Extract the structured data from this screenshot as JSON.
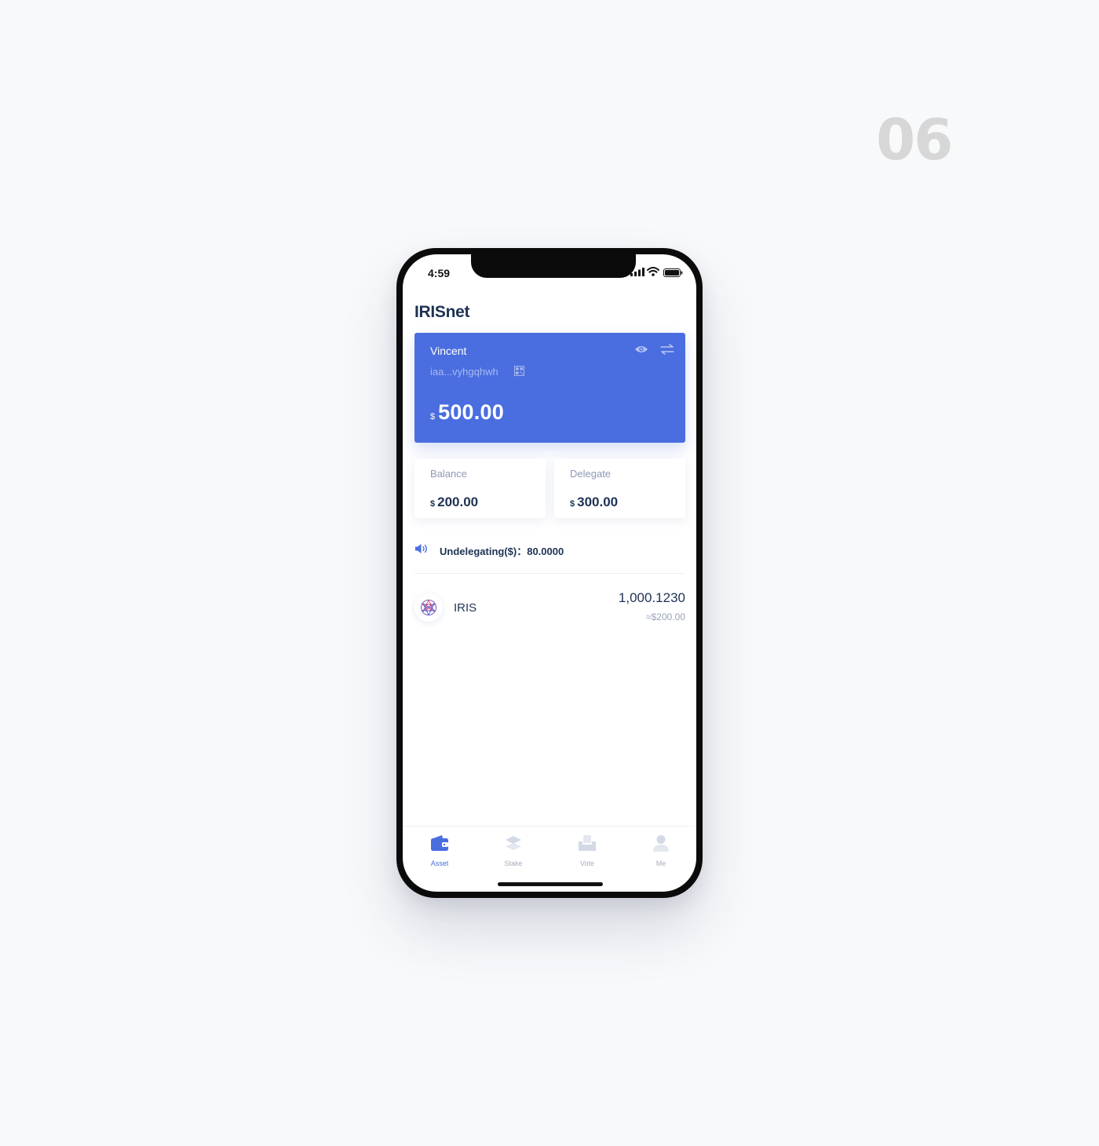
{
  "slide": {
    "number": "06"
  },
  "status_bar": {
    "time": "4:59"
  },
  "app": {
    "title": "IRISnet"
  },
  "wallet": {
    "name": "Vincent",
    "address": "iaa...vyhgqhwh",
    "currency_symbol": "$",
    "total": "500.00"
  },
  "summary": {
    "balance": {
      "label": "Balance",
      "currency": "$",
      "value": "200.00"
    },
    "delegate": {
      "label": "Delegate",
      "currency": "$",
      "value": "300.00"
    }
  },
  "notice": {
    "text": "Undelegating($)：80.0000"
  },
  "assets": [
    {
      "name": "IRIS",
      "amount": "1,000.1230",
      "fiat": "≈$200.00",
      "icon": "iris-logo-icon"
    }
  ],
  "tabs": [
    {
      "label": "Asset",
      "icon": "wallet-icon",
      "active": true
    },
    {
      "label": "Stake",
      "icon": "layers-icon",
      "active": false
    },
    {
      "label": "Vote",
      "icon": "ballot-box-icon",
      "active": false
    },
    {
      "label": "Me",
      "icon": "user-icon",
      "active": false
    }
  ],
  "colors": {
    "primary": "#4a6ee0",
    "text_dark": "#1f3253",
    "text_muted": "#8e99b3",
    "tab_inactive": "#a5aebf",
    "background": "#f8f9fb"
  }
}
